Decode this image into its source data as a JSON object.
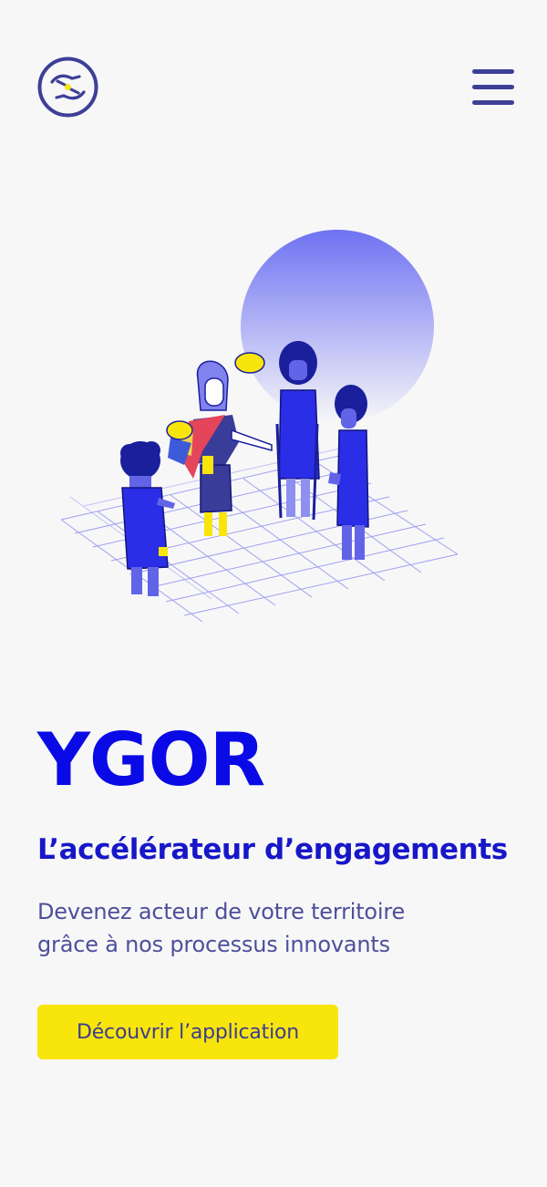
{
  "header": {
    "logo_icon": "hands-exchange-icon",
    "menu_icon": "hamburger-menu-icon"
  },
  "hero": {
    "illustration": "people-conversation-illustration",
    "brand": "YGOR",
    "tagline": "L’accélérateur d’engagements",
    "description": "Devenez acteur de votre territoire\ngrâce à nos  processus innovants",
    "cta_label": "Découvrir l’application"
  },
  "colors": {
    "background": "#f7f7f8",
    "brand_blue": "#0a0ae6",
    "tagline_blue": "#1717c8",
    "text_muted": "#4d4f9b",
    "navy": "#3d3f96",
    "cta_yellow": "#f8e50c"
  }
}
